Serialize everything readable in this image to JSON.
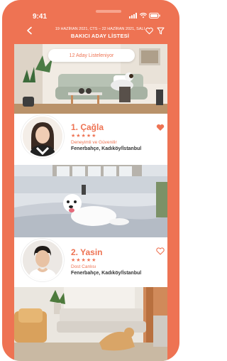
{
  "status": {
    "time": "9:41"
  },
  "header": {
    "date_range": "19 HAZİRAN 2021, CTS – 22 HAZİRAN 2021, SALI",
    "title": "BAKICI ADAY LİSTESİ"
  },
  "count_label": "12 Aday Listeleniyor",
  "candidates": [
    {
      "rank_name": "1. Çağla",
      "stars": "★★★★★",
      "skill": "Deneyimli ve Güvenilir",
      "location": "Fenerbahçe, Kadıköy/İstanbul",
      "favorited": true
    },
    {
      "rank_name": "2. Yasin",
      "stars": "★★★★★",
      "skill": "Dost Canlısı",
      "location": "Fenerbahçe, Kadıköy/İstanbul",
      "favorited": false
    }
  ],
  "colors": {
    "accent": "#ee7353"
  },
  "icons": [
    "back-arrow-icon",
    "heart-outline-icon",
    "filter-icon",
    "heart-filled-icon"
  ]
}
